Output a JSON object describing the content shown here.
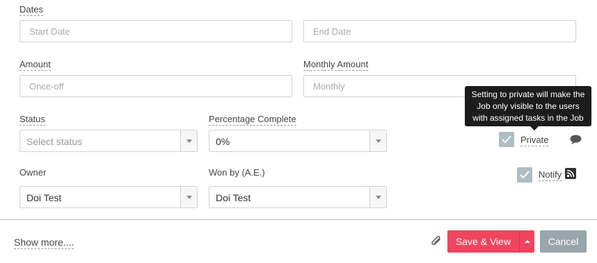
{
  "dates": {
    "label": "Dates",
    "start_placeholder": "Start Date",
    "end_placeholder": "End Date"
  },
  "amount": {
    "label": "Amount",
    "placeholder": "Once-off"
  },
  "monthly_amount": {
    "label": "Monthly Amount",
    "placeholder": "Monthly"
  },
  "tooltip": {
    "line1": "Setting to private will make the",
    "line2": "Job only visible to the users",
    "line3": "with assigned tasks in the Job"
  },
  "status": {
    "label": "Status",
    "placeholder": "Select status"
  },
  "percentage": {
    "label": "Percentage Complete",
    "value": "0%"
  },
  "private": {
    "label": "Private",
    "checked": true
  },
  "notify": {
    "label": "Notify",
    "checked": true
  },
  "owner": {
    "label": "Owner",
    "value": "Doi Test"
  },
  "won_by": {
    "label": "Won by (A.E.)",
    "value": "Doi Test"
  },
  "footer": {
    "show_more": "Show more....",
    "save_label": "Save & View",
    "cancel_label": "Cancel"
  },
  "icons": {
    "comment": "comment-icon",
    "rss": "rss-icon",
    "attachment": "paperclip-icon",
    "check": "checkmark-icon"
  },
  "colors": {
    "primary": "#f0445f",
    "cancel": "#99a6ab",
    "checkbox": "#aebdc3",
    "tooltip_bg": "#1c1c1c"
  }
}
